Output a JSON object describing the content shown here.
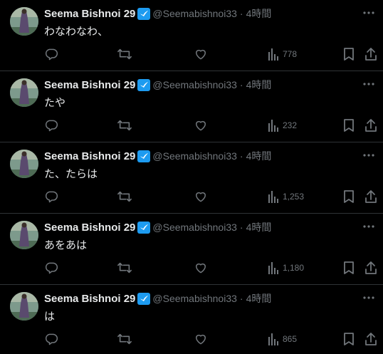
{
  "tweets": [
    {
      "name": "Seema Bishnoi 29",
      "handle": "@Seemabishnoi33",
      "separator": "·",
      "time": "4時間",
      "text": "わなわなわ、",
      "views": "778"
    },
    {
      "name": "Seema Bishnoi 29",
      "handle": "@Seemabishnoi33",
      "separator": "·",
      "time": "4時間",
      "text": "たや",
      "views": "232"
    },
    {
      "name": "Seema Bishnoi 29",
      "handle": "@Seemabishnoi33",
      "separator": "·",
      "time": "4時間",
      "text": "た、たらは",
      "views": "1,253"
    },
    {
      "name": "Seema Bishnoi 29",
      "handle": "@Seemabishnoi33",
      "separator": "·",
      "time": "4時間",
      "text": "あをあは",
      "views": "1,180"
    },
    {
      "name": "Seema Bishnoi 29",
      "handle": "@Seemabishnoi33",
      "separator": "·",
      "time": "4時間",
      "text": "は",
      "views": "865"
    }
  ],
  "icons": {
    "verified": "verified-badge-icon",
    "more": "more-icon",
    "reply": "reply-icon",
    "retweet": "retweet-icon",
    "like": "like-icon",
    "views": "views-icon",
    "bookmark": "bookmark-icon",
    "share": "share-icon"
  },
  "colors": {
    "background": "#000000",
    "text": "#e7e9ea",
    "muted": "#71767b",
    "divider": "#2f3336",
    "verified": "#1d9bf0"
  }
}
